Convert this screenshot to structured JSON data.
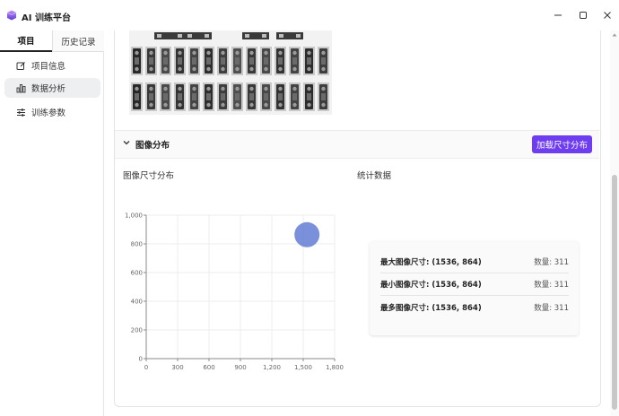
{
  "window": {
    "title": "AI 训练平台",
    "logo_icon": "app-logo-icon",
    "colors": {
      "logo_top": "#a15cf0",
      "logo_bottom": "#5b3fd6"
    }
  },
  "sidebar": {
    "tabs": [
      {
        "label": "项目",
        "active": true
      },
      {
        "label": "历史记录",
        "active": false
      }
    ],
    "items": [
      {
        "label": "项目信息",
        "icon": "edit-icon",
        "active": false
      },
      {
        "label": "数据分析",
        "icon": "bar-chart-icon",
        "active": true
      },
      {
        "label": "训练参数",
        "icon": "sliders-icon",
        "active": false
      }
    ]
  },
  "section": {
    "title": "图像分布",
    "load_button": "加载尺寸分布",
    "accent": "#6f3df0"
  },
  "chart_title": "图像尺寸分布",
  "stats_title": "统计数据",
  "stats": [
    {
      "label": "最大图像尺寸: (1536, 864)",
      "count": "数量: 311"
    },
    {
      "label": "最小图像尺寸: (1536, 864)",
      "count": "数量: 311"
    },
    {
      "label": "最多图像尺寸: (1536, 864)",
      "count": "数量: 311"
    }
  ],
  "chart_data": {
    "type": "scatter",
    "title": "",
    "xlabel": "",
    "ylabel": "",
    "xlim": [
      0,
      1800
    ],
    "ylim": [
      0,
      1000
    ],
    "x_ticks": [
      "0",
      "300",
      "600",
      "900",
      "1,200",
      "1,500",
      "1,800"
    ],
    "y_ticks": [
      "0",
      "200",
      "400",
      "600",
      "800",
      "1,000"
    ],
    "x_tick_values": [
      0,
      300,
      600,
      900,
      1200,
      1500,
      1800
    ],
    "y_tick_values": [
      0,
      200,
      400,
      600,
      800,
      1000
    ],
    "grid": true,
    "series": [
      {
        "points": [
          {
            "x": 1536,
            "y": 864,
            "count": 311
          }
        ],
        "color": "#6b84d6"
      }
    ]
  }
}
